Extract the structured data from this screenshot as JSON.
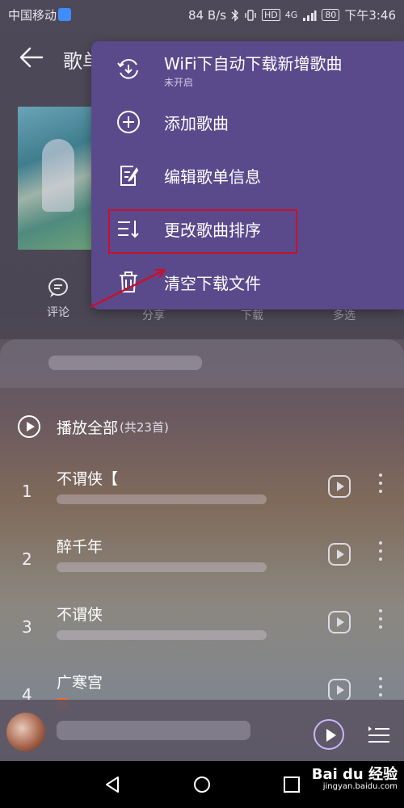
{
  "status_bar": {
    "carrier": "中国移动",
    "speed": "84 B/s",
    "network": "4G",
    "battery": "80",
    "time": "下午3:46"
  },
  "header": {
    "title": "歌单"
  },
  "actions": [
    {
      "label": "评论",
      "icon": "comment-icon"
    },
    {
      "label": "分享",
      "icon": "share-icon"
    },
    {
      "label": "下载",
      "icon": "download-icon"
    },
    {
      "label": "多选",
      "icon": "multiselect-icon"
    }
  ],
  "list": {
    "play_all_label": "播放全部",
    "play_all_count": "(共23首)",
    "songs": [
      {
        "num": "1",
        "title": "不谓侠【"
      },
      {
        "num": "2",
        "title": "醉千年"
      },
      {
        "num": "3",
        "title": "不谓侠"
      },
      {
        "num": "4",
        "title": "广寒宫"
      }
    ]
  },
  "menu": {
    "items": [
      {
        "label": "WiFi下自动下载新增歌曲",
        "sublabel": "未开启",
        "icon": "wifi-download-icon"
      },
      {
        "label": "添加歌曲",
        "icon": "add-circle-icon"
      },
      {
        "label": "编辑歌单信息",
        "icon": "edit-icon"
      },
      {
        "label": "更改歌曲排序",
        "icon": "sort-icon"
      },
      {
        "label": "清空下载文件",
        "icon": "trash-icon"
      }
    ]
  },
  "watermark": {
    "brand": "Bai du 经验",
    "url": "jingyan.baidu.com"
  },
  "colors": {
    "menu_bg": "#5a4a8c",
    "highlight": "#c8102e",
    "accent": "#c9b6ff"
  }
}
